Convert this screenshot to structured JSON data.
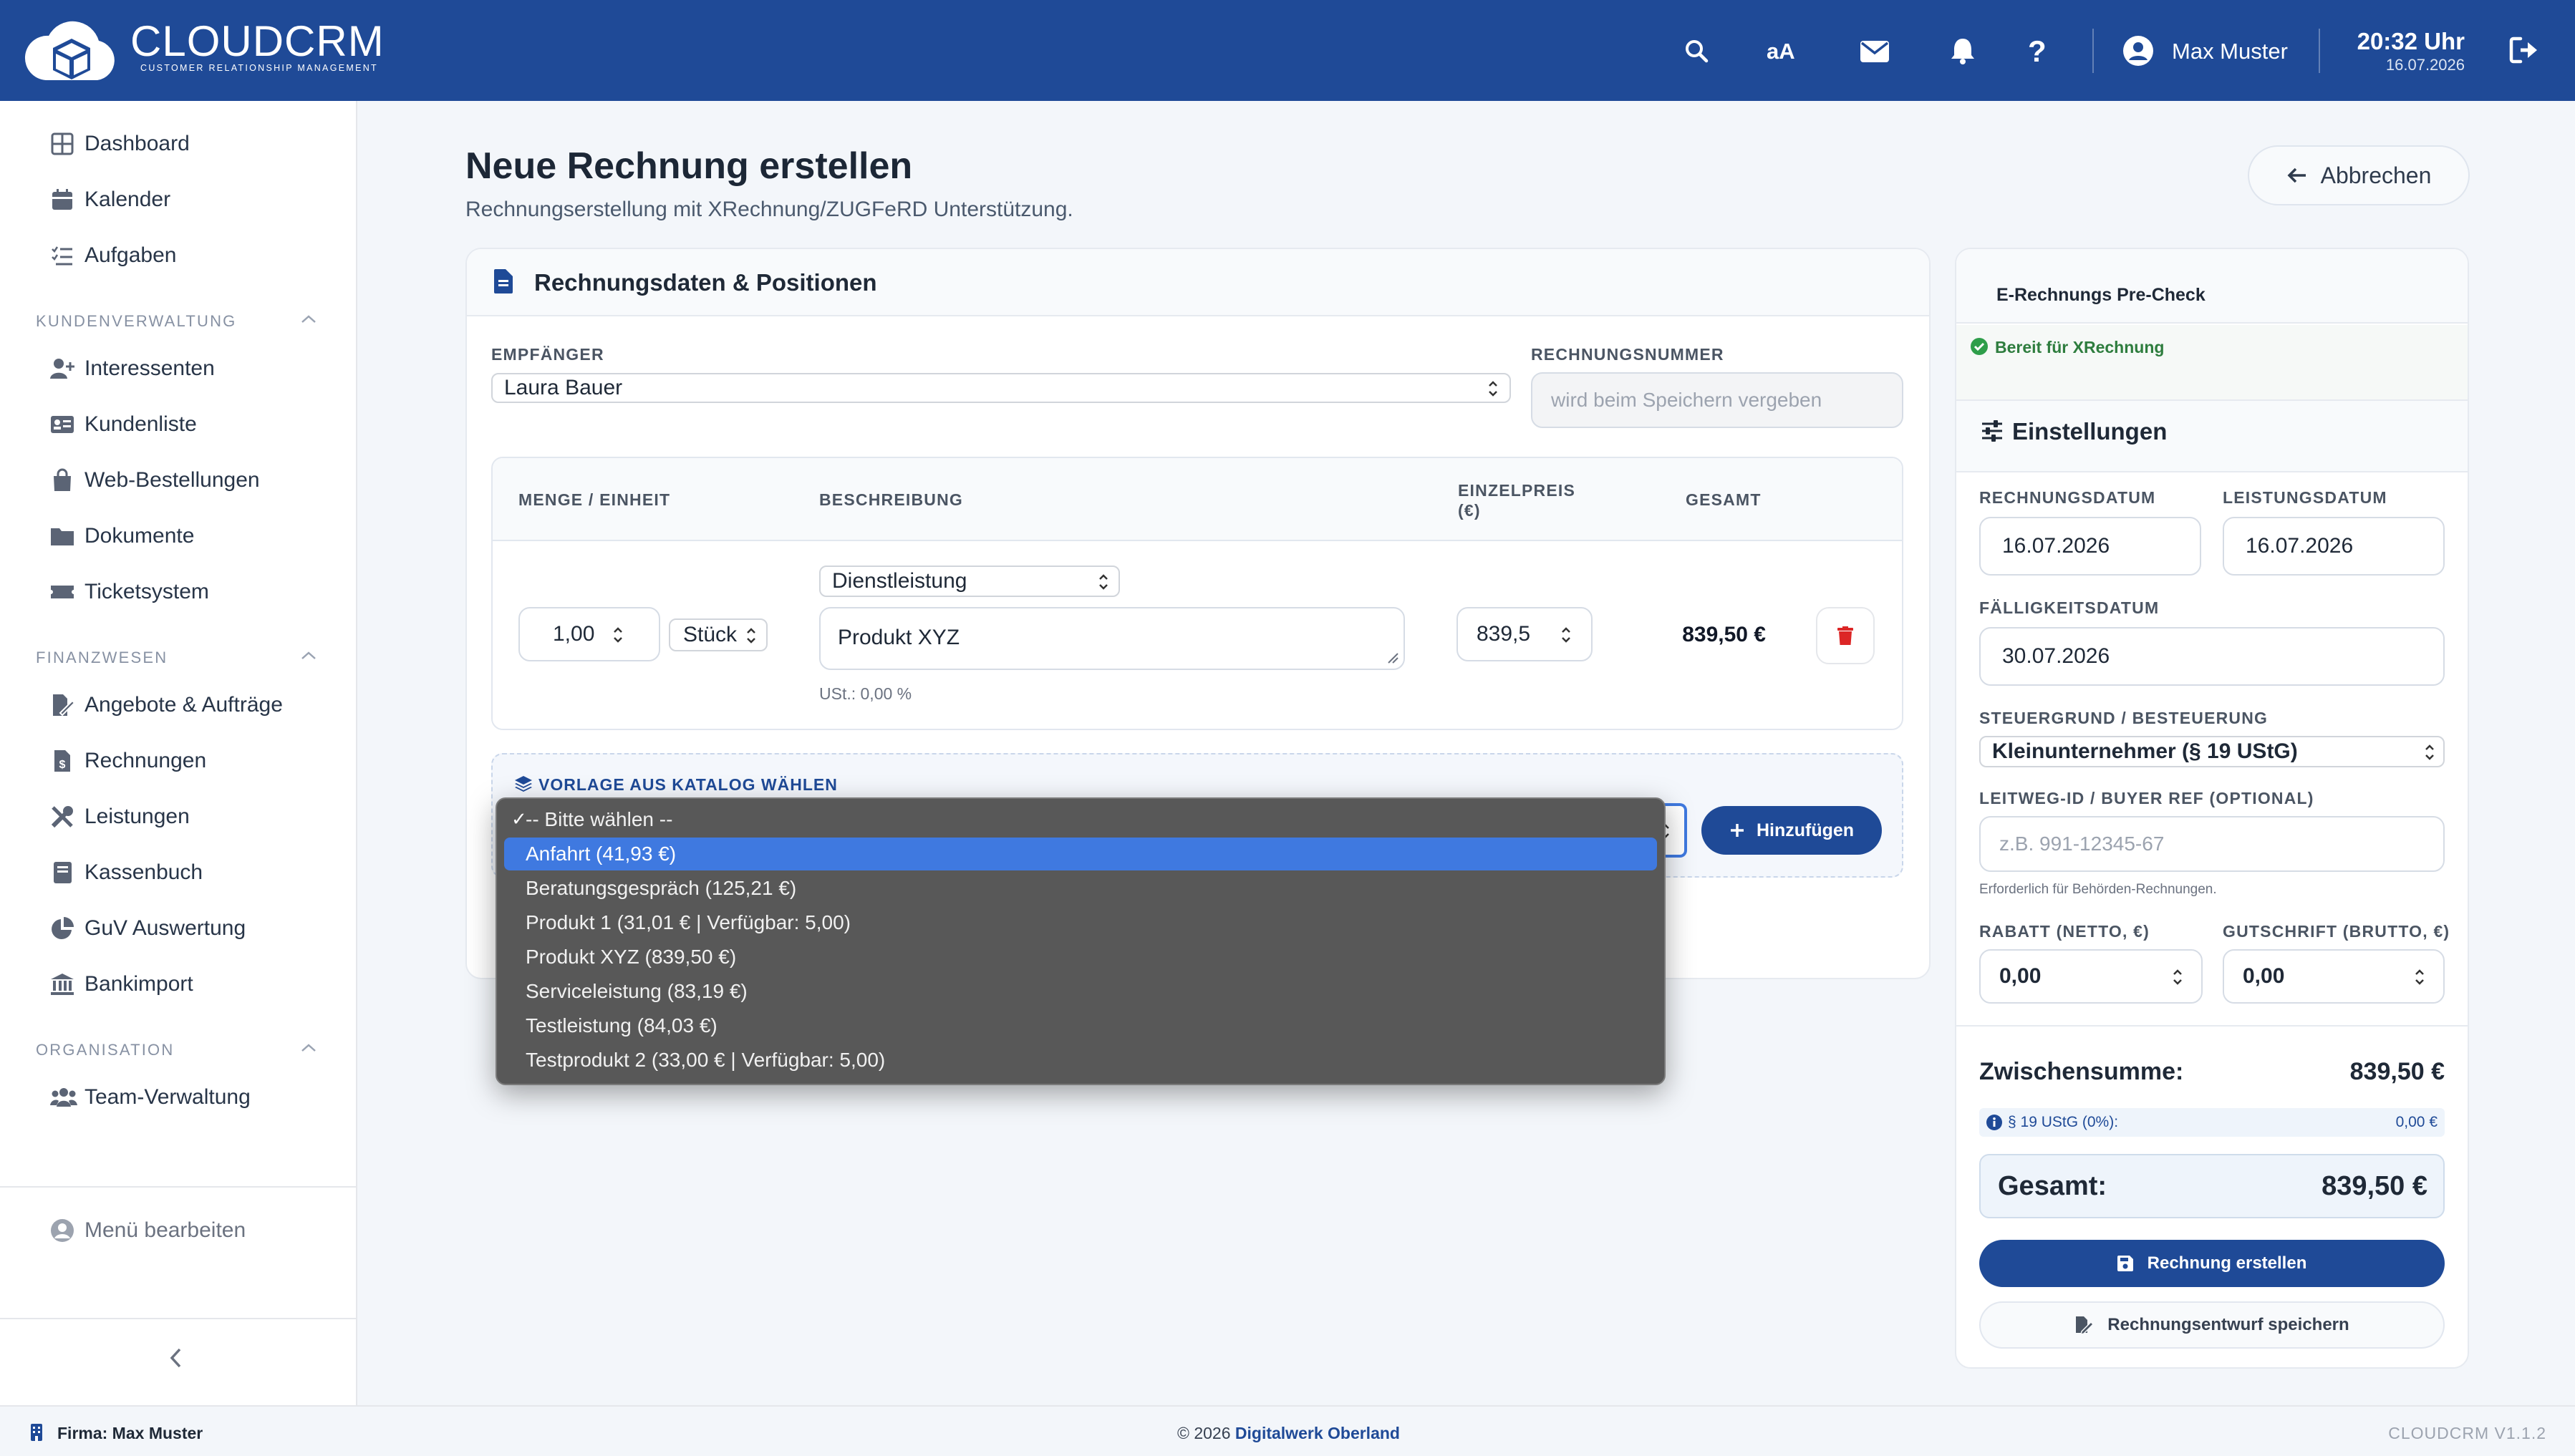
{
  "header": {
    "brand": "CLOUDCRM",
    "brand_sub": "CUSTOMER RELATIONSHIP MANAGEMENT",
    "font_toggle": "aA",
    "user_name": "Max Muster",
    "time": "20:32 Uhr",
    "date": "16.07.2026"
  },
  "sidebar": {
    "top_items": [
      {
        "label": "Dashboard",
        "icon": "dashboard-icon"
      },
      {
        "label": "Kalender",
        "icon": "calendar-icon"
      },
      {
        "label": "Aufgaben",
        "icon": "tasks-icon"
      }
    ],
    "sections": [
      {
        "title": "KUNDENVERWALTUNG",
        "items": [
          {
            "label": "Interessenten",
            "icon": "user-plus-icon"
          },
          {
            "label": "Kundenliste",
            "icon": "address-card-icon"
          },
          {
            "label": "Web-Bestellungen",
            "icon": "shopping-bag-icon"
          },
          {
            "label": "Dokumente",
            "icon": "folder-icon"
          },
          {
            "label": "Ticketsystem",
            "icon": "ticket-icon"
          }
        ]
      },
      {
        "title": "FINANZWESEN",
        "items": [
          {
            "label": "Angebote & Aufträge",
            "icon": "file-signature-icon"
          },
          {
            "label": "Rechnungen",
            "icon": "invoice-icon"
          },
          {
            "label": "Leistungen",
            "icon": "tools-icon"
          },
          {
            "label": "Kassenbuch",
            "icon": "book-icon"
          },
          {
            "label": "GuV Auswertung",
            "icon": "pie-chart-icon"
          },
          {
            "label": "Bankimport",
            "icon": "bank-icon"
          }
        ]
      },
      {
        "title": "ORGANISATION",
        "items": [
          {
            "label": "Team-Verwaltung",
            "icon": "users-icon"
          }
        ]
      }
    ],
    "edit_menu": "Menü bearbeiten"
  },
  "page": {
    "title": "Neue Rechnung erstellen",
    "subtitle": "Rechnungserstellung mit XRechnung/ZUGFeRD Unterstützung.",
    "cancel_button": "Abbrechen"
  },
  "form": {
    "card_title": "Rechnungsdaten & Positionen",
    "recipient_label": "EMPFÄNGER",
    "recipient_value": "Laura Bauer",
    "invoice_number_label": "RECHNUNGSNUMMER",
    "invoice_number_placeholder": "wird beim Speichern vergeben",
    "table_headers": {
      "qty": "MENGE / EINHEIT",
      "desc": "BESCHREIBUNG",
      "price_line1": "EINZELPREIS",
      "price_line2": "(€)",
      "total": "GESAMT"
    },
    "line_items": [
      {
        "qty": "1,00",
        "unit": "Stück",
        "type": "Dienstleistung",
        "description": "Produkt XYZ",
        "vat_note": "USt.: 0,00 %",
        "unit_price": "839,5",
        "total": "839,50 €"
      }
    ],
    "catalog_label": "VORLAGE AUS KATALOG WÄHLEN",
    "add_button": "Hinzufügen",
    "catalog_dropdown": {
      "options": [
        "-- Bitte wählen --",
        "Anfahrt (41,93 €)",
        "Beratungsgespräch (125,21 €)",
        "Produkt 1 (31,01 € | Verfügbar: 5,00)",
        "Produkt XYZ (839,50 €)",
        "Serviceleistung (83,19 €)",
        "Testleistung (84,03 €)",
        "Testprodukt 2 (33,00 € | Verfügbar: 5,00)"
      ],
      "checked_mark": "✓",
      "checked_index": 0,
      "highlighted_index": 1
    }
  },
  "precheck": {
    "title": "E-Rechnungs Pre-Check",
    "status": "Bereit für XRechnung"
  },
  "settings": {
    "title": "Einstellungen",
    "invoice_date_label": "RECHNUNGSDATUM",
    "invoice_date": "16.07.2026",
    "service_date_label": "LEISTUNGSDATUM",
    "service_date": "16.07.2026",
    "due_date_label": "FÄLLIGKEITSDATUM",
    "due_date": "30.07.2026",
    "tax_label": "STEUERGRUND / BESTEUERUNG",
    "tax_value": "Kleinunternehmer (§ 19 UStG)",
    "leitweg_label": "LEITWEG-ID / BUYER REF (OPTIONAL)",
    "leitweg_placeholder": "z.B. 991-12345-67",
    "leitweg_hint": "Erforderlich für Behörden-Rechnungen.",
    "discount_label": "RABATT (NETTO, €)",
    "discount_value": "0,00",
    "credit_label": "GUTSCHRIFT (BRUTTO, €)",
    "credit_value": "0,00",
    "subtotal_label": "Zwischensumme:",
    "subtotal_value": "839,50 €",
    "tax_line_label": "§ 19 UStG (0%):",
    "tax_line_value": "0,00 €",
    "total_label": "Gesamt:",
    "total_value": "839,50 €",
    "create_button": "Rechnung erstellen",
    "draft_button": "Rechnungsentwurf speichern"
  },
  "footer": {
    "company": "Firma: Max Muster",
    "copyright_prefix": "© 2026",
    "copyright_link": "Digitalwerk Oberland",
    "version": "CLOUDCRM V1.1.2"
  },
  "colors": {
    "brand_blue": "#1f4a97",
    "dropdown_bg": "#585858",
    "dropdown_highlight": "#3f79e0",
    "success_green": "#2e9e4a",
    "danger_red": "#dc2626"
  }
}
